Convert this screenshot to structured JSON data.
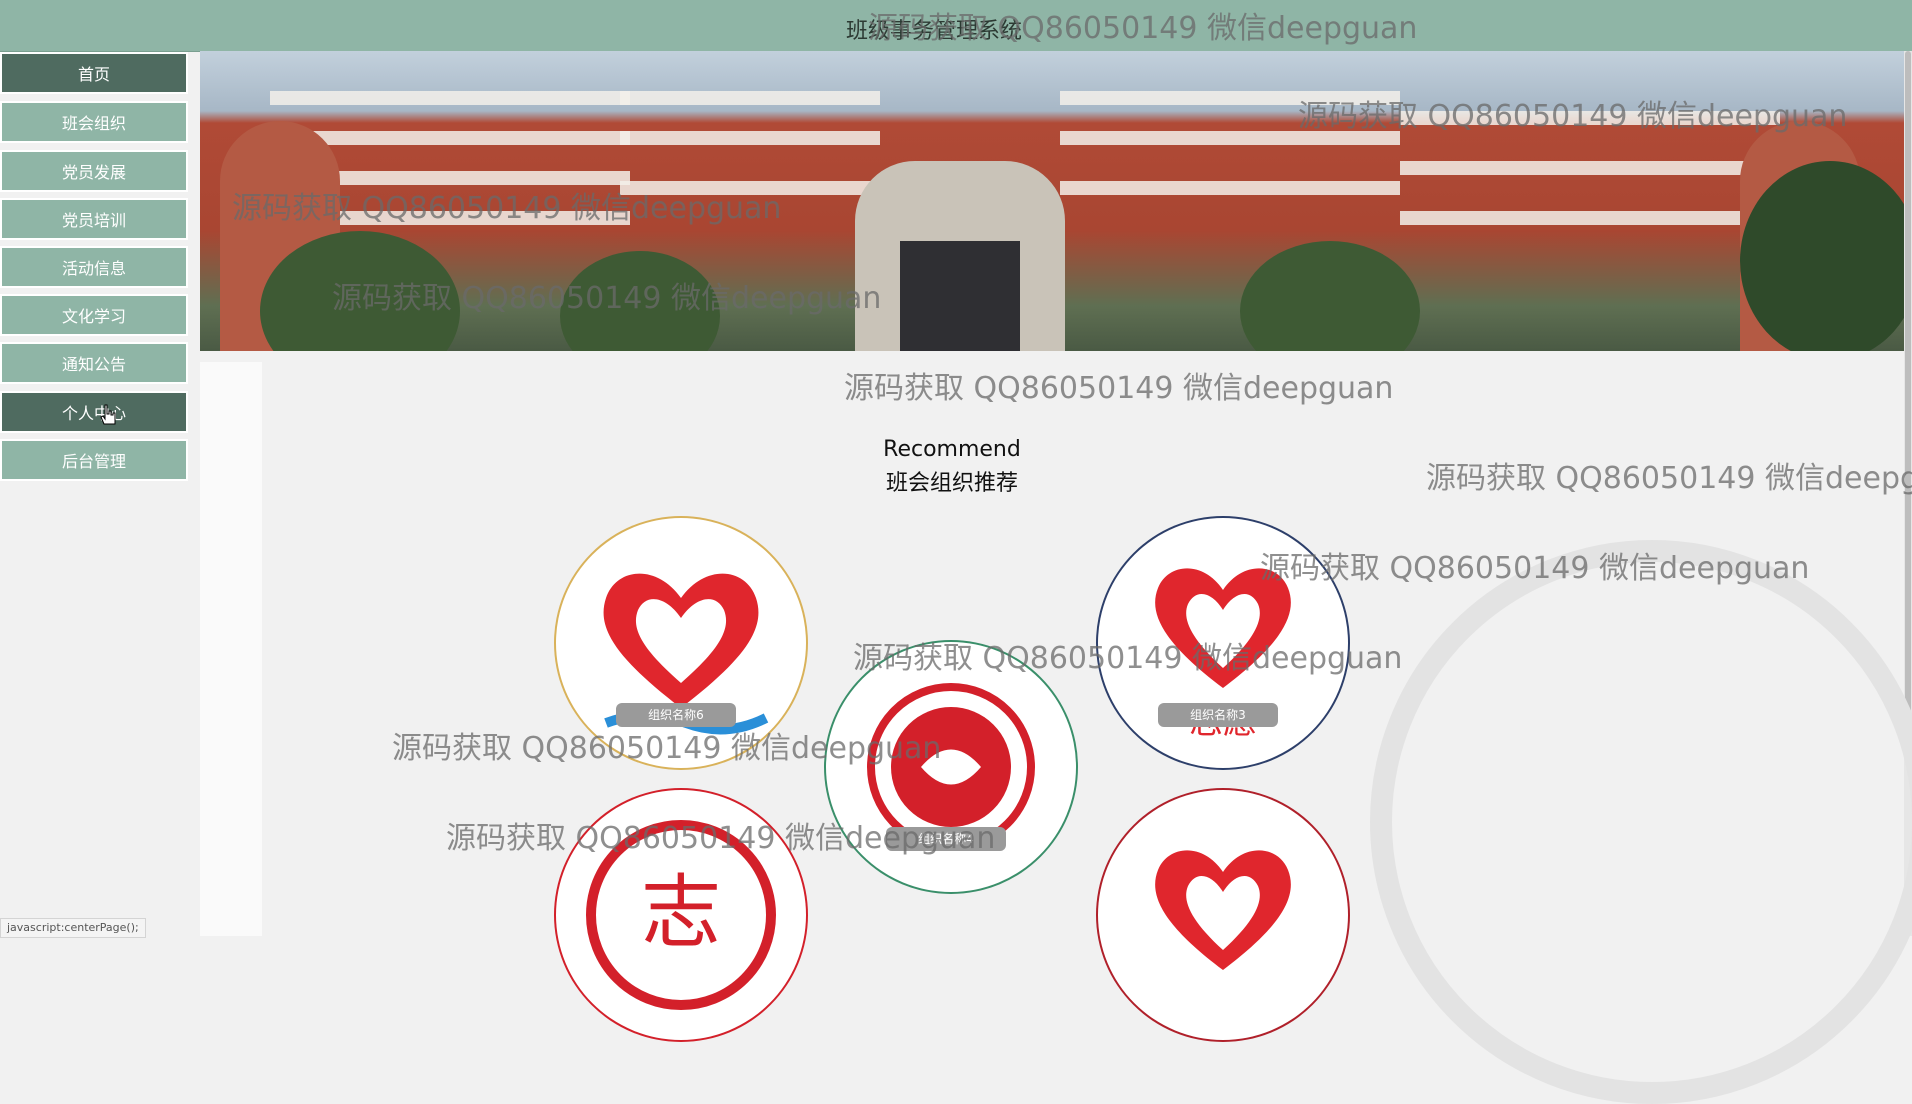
{
  "header": {
    "title": "班级事务管理系统"
  },
  "sidebar": {
    "items": [
      {
        "label": "首页"
      },
      {
        "label": "班会组织"
      },
      {
        "label": "党员发展"
      },
      {
        "label": "党员培训"
      },
      {
        "label": "活动信息"
      },
      {
        "label": "文化学习"
      },
      {
        "label": "通知公告"
      },
      {
        "label": "个人中心"
      },
      {
        "label": "后台管理"
      }
    ]
  },
  "recommend": {
    "heading_en": "Recommend",
    "heading_zh": "班会组织推荐",
    "orgs": [
      {
        "label": "组织名称6"
      },
      {
        "label": "组织名称3"
      },
      {
        "label": "组织名称4"
      }
    ]
  },
  "watermark": {
    "text": "源码获取 QQ86050149 微信deepguan"
  },
  "statusbar": {
    "text": "javascript:centerPage();"
  }
}
